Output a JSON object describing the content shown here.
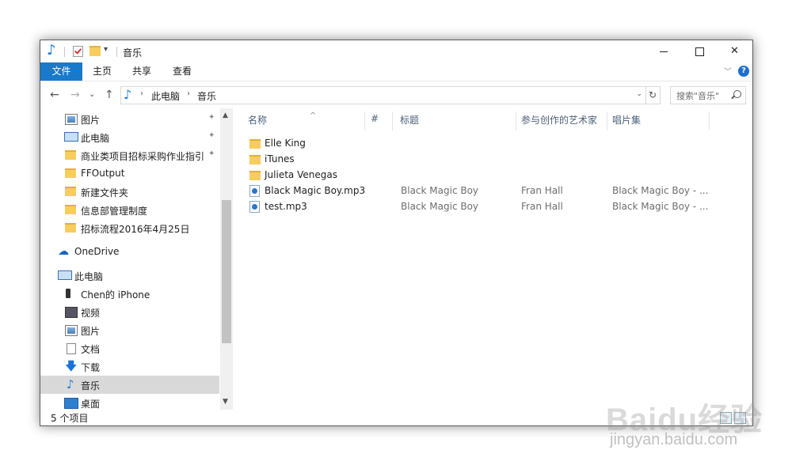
{
  "window": {
    "title": "音乐"
  },
  "title_controls": {
    "minimize": "—",
    "maximize": "☐",
    "close": "✕"
  },
  "ribbon": {
    "tabs": [
      {
        "label": "文件",
        "active": true
      },
      {
        "label": "主页"
      },
      {
        "label": "共享"
      },
      {
        "label": "查看"
      }
    ],
    "expand": "﹀",
    "help": "?"
  },
  "address": {
    "back": "←",
    "forward": "→",
    "recent": "⌄",
    "up": "↑",
    "crumbs": [
      "此电脑",
      "音乐"
    ],
    "dropdown": "⌄",
    "refresh": "↻",
    "search_placeholder": "搜索\"音乐\""
  },
  "nav": {
    "items": [
      {
        "label": "图片",
        "icon": "pictures-icon",
        "pinned": true
      },
      {
        "label": "此电脑",
        "icon": "computer-icon",
        "pinned": true
      },
      {
        "label": "商业类项目招标采购作业指引",
        "icon": "folder-icon",
        "pinned": true
      },
      {
        "label": "FFOutput",
        "icon": "folder-icon"
      },
      {
        "label": "新建文件夹",
        "icon": "folder-icon"
      },
      {
        "label": "信息部管理制度",
        "icon": "folder-icon"
      },
      {
        "label": "招标流程2016年4月25日",
        "icon": "folder-icon"
      },
      {
        "label": "OneDrive",
        "icon": "onedrive-cloud-icon"
      },
      {
        "label": "此电脑",
        "icon": "computer-icon"
      },
      {
        "label": "Chen的 iPhone",
        "icon": "iphone-icon"
      },
      {
        "label": "视频",
        "icon": "video-icon"
      },
      {
        "label": "图片",
        "icon": "pictures-icon"
      },
      {
        "label": "文档",
        "icon": "documents-icon"
      },
      {
        "label": "下载",
        "icon": "download-icon"
      },
      {
        "label": "音乐",
        "icon": "music-icon",
        "selected": true
      },
      {
        "label": "桌面",
        "icon": "desktop-icon"
      }
    ]
  },
  "columns": [
    "名称",
    "#",
    "标题",
    "参与创作的艺术家",
    "唱片集"
  ],
  "files": [
    {
      "name": "Elle King",
      "type": "folder",
      "title": "",
      "artist": "",
      "album": ""
    },
    {
      "name": "iTunes",
      "type": "folder",
      "title": "",
      "artist": "",
      "album": ""
    },
    {
      "name": "Julieta Venegas",
      "type": "folder",
      "title": "",
      "artist": "",
      "album": ""
    },
    {
      "name": "Black Magic Boy.mp3",
      "type": "mp3",
      "title": "Black Magic Boy",
      "artist": "Fran Hall",
      "album": "Black Magic Boy - ..."
    },
    {
      "name": "test.mp3",
      "type": "mp3",
      "title": "Black Magic Boy",
      "artist": "Fran Hall",
      "album": "Black Magic Boy - ..."
    }
  ],
  "status": {
    "count_text": "5 个项目"
  },
  "watermark": {
    "logo": "Baidu经验",
    "url": "jingyan.baidu.com"
  }
}
